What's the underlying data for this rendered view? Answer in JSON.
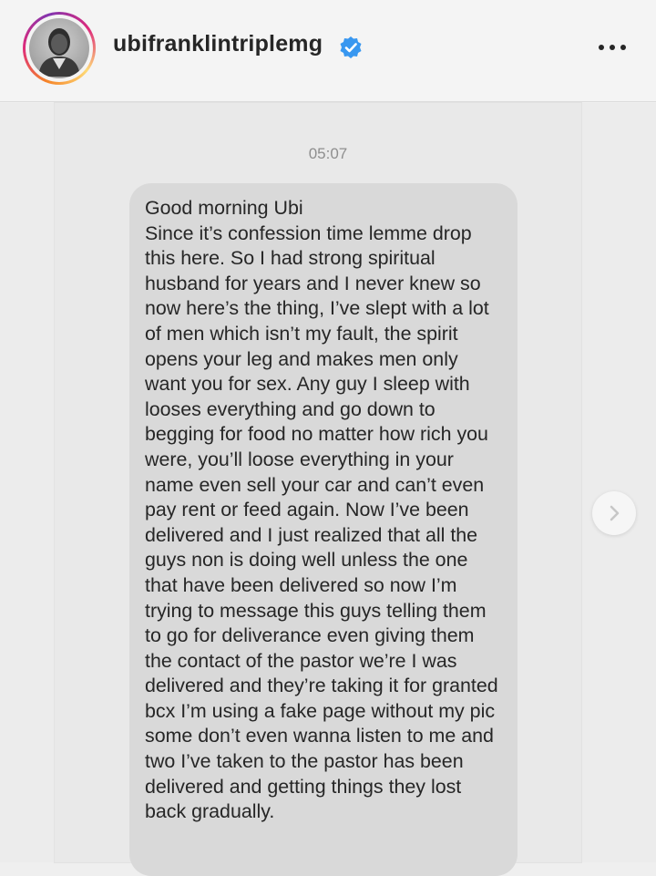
{
  "header": {
    "username": "ubifranklintriplemg",
    "verified": true,
    "avatar_icon": "profile-photo",
    "more_icon": "more-horizontal-icon"
  },
  "chat": {
    "timestamp": "05:07",
    "message": "Good morning Ubi\nSince it’s confession time lemme drop this here. So I had strong spiritual husband for years and I never knew so now here’s the thing, I’ve slept with a lot of men which isn’t my fault, the spirit opens your leg and makes men only want you for sex. Any guy I sleep with looses everything and go down to begging for food no matter how rich you were, you’ll loose everything in your name even sell your car and can’t even pay rent or feed again. Now I’ve been delivered and I just realized that all the guys non is doing well unless the one that have been delivered so now I’m trying to message this guys telling them to go for deliverance even giving them the contact of the pastor we’re I was delivered and they’re taking it for granted bcx I’m using a fake page without my pic some don’t even wanna listen to me and two I’ve taken to the pastor has been delivered and getting things they lost back gradually.",
    "next_icon": "chevron-right-icon"
  },
  "colors": {
    "verified_badge": "#3897f0",
    "bubble": "#d9d9d9",
    "text": "#262626"
  }
}
